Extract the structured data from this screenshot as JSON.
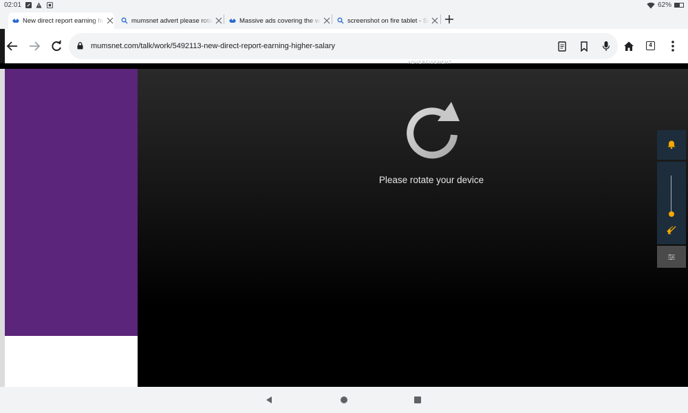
{
  "status_bar": {
    "time": "02:01",
    "battery": "62%",
    "battery_level": 0.62,
    "notification_icons": [
      "edit-icon",
      "warning-icon",
      "app-icon"
    ]
  },
  "tabs": [
    {
      "title": "New direct report earning higher salary",
      "favicon": "mumsnet-icon",
      "active": true
    },
    {
      "title": "mumsnet advert please rotate your device",
      "favicon": "search-icon",
      "active": false
    },
    {
      "title": "Massive ads covering the whole page",
      "favicon": "mumsnet-icon",
      "active": false
    },
    {
      "title": "screenshot on fire tablet - Search",
      "favicon": "search-icon",
      "active": false
    }
  ],
  "toolbar": {
    "url": "mumsnet.com/talk/work/5492113-new-direct-report-earning-higher-salary",
    "tab_count": "4"
  },
  "ad_label": "ADVERTISEMENT",
  "ad": {
    "message": "Please rotate your device"
  },
  "colors": {
    "mumsnet_purple": "#5a257a",
    "widget_bg": "#1d2d3c",
    "accent_orange": "#f5a800"
  }
}
